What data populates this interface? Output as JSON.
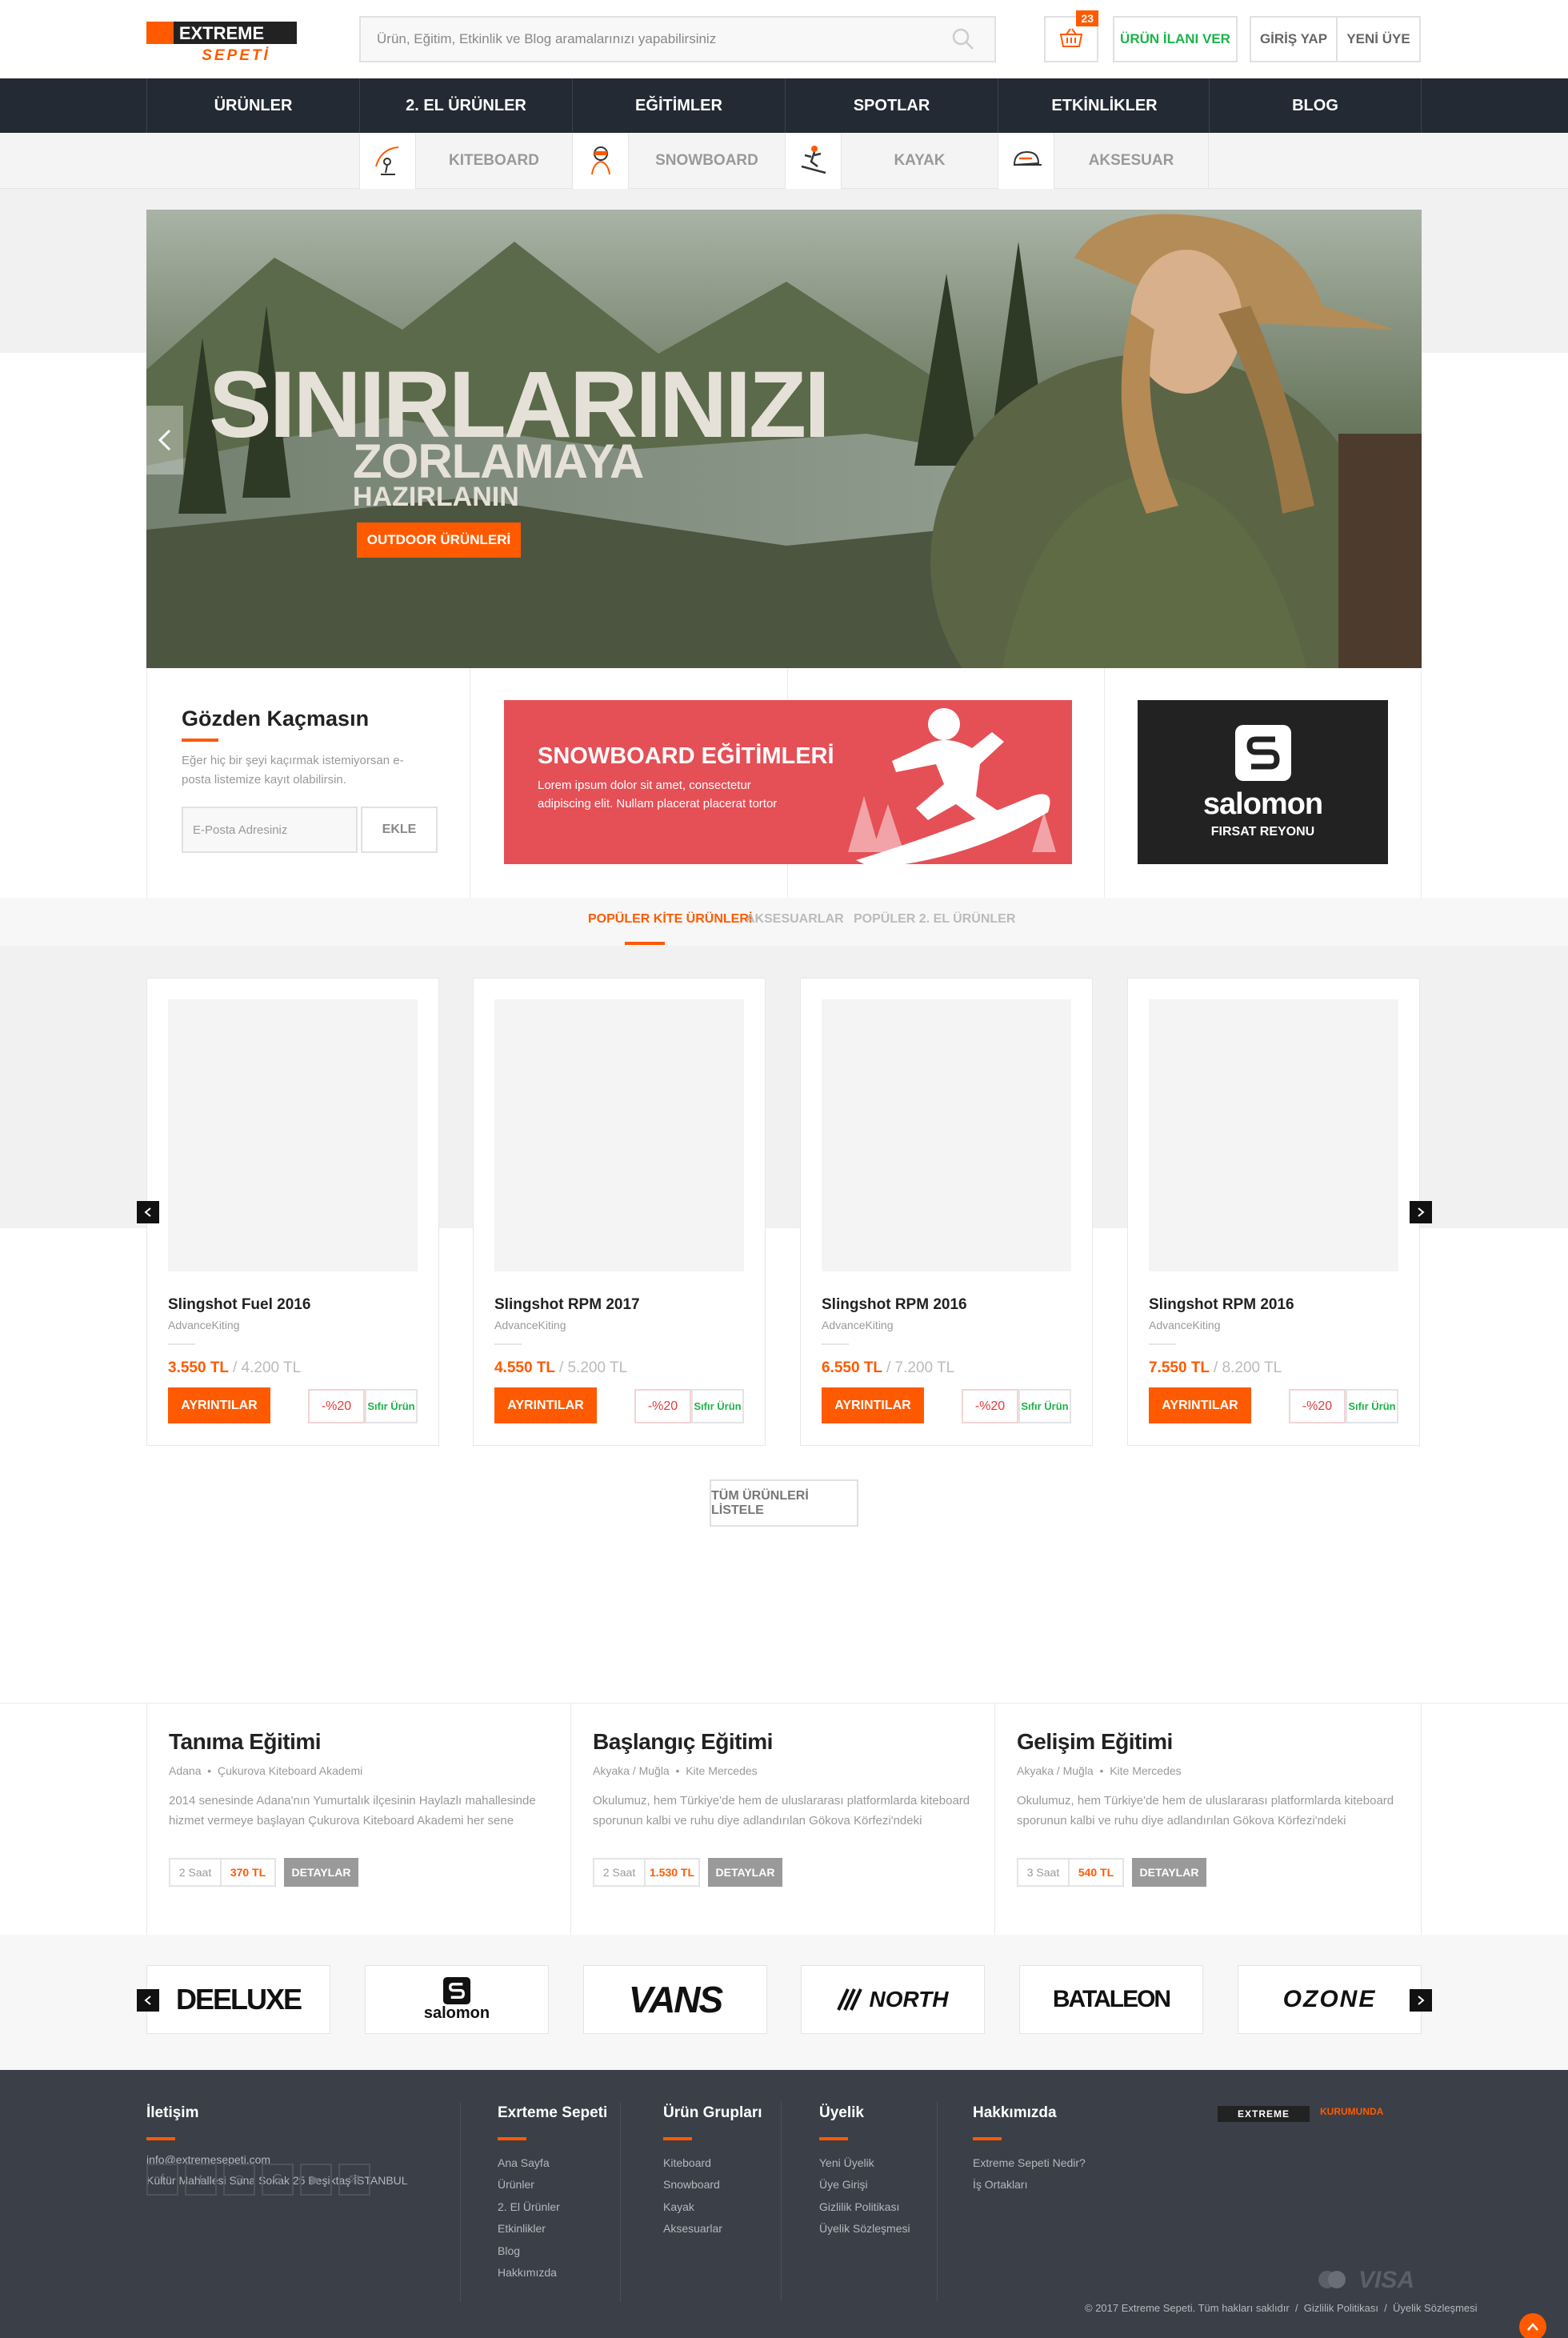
{
  "header": {
    "logo_top": "EXTREME",
    "logo_bottom": "SEPETİ",
    "search_placeholder": "Ürün, Eğitim, Etkinlik ve Blog aramalarınızı yapabilirsiniz",
    "cart_count": "23",
    "post_ad_label": "ÜRÜN İLANI VER",
    "login_label": "GİRİŞ YAP",
    "register_label": "YENİ ÜYE"
  },
  "nav": {
    "items": [
      "ÜRÜNLER",
      "2. EL ÜRÜNLER",
      "EĞİTİMLER",
      "SPOTLAR",
      "ETKİNLİKLER",
      "BLOG"
    ]
  },
  "subnav": {
    "items": [
      {
        "label": "KITEBOARD",
        "icon": "kiteboard-icon"
      },
      {
        "label": "SNOWBOARD",
        "icon": "snowboard-icon"
      },
      {
        "label": "KAYAK",
        "icon": "ski-icon"
      },
      {
        "label": "AKSESUAR",
        "icon": "cap-icon"
      }
    ]
  },
  "hero": {
    "title": "SINIRLARINIZI",
    "subtitle1": "ZORLAMAYA",
    "subtitle2": "HAZIRLANIN",
    "button": "OUTDOOR ÜRÜNLERİ"
  },
  "newsletter": {
    "title": "Gözden Kaçmasın",
    "desc": "Eğer hiç bir şeyi kaçırmak istemiyorsan e-posta listemize kayıt olabilirsin.",
    "placeholder": "E-Posta Adresiniz",
    "button": "EKLE"
  },
  "snowboard_banner": {
    "title": "SNOWBOARD EĞİTİMLERİ",
    "desc": "Lorem ipsum dolor sit amet, consectetur adipiscing elit. Nullam placerat placerat tortor"
  },
  "salomon_banner": {
    "brand": "salomon",
    "subtitle": "FIRSAT REYONU"
  },
  "tabs": [
    "POPÜLER KİTE ÜRÜNLERİ",
    "AKSESUARLAR",
    "POPÜLER 2. EL ÜRÜNLER"
  ],
  "products": [
    {
      "name": "Slingshot Fuel 2016",
      "brand": "AdvanceKiting",
      "price": "3.550 TL",
      "old_price": "/ 4.200 TL",
      "button": "AYRINTILAR",
      "discount": "-%20",
      "badge": "Sıfır Ürün"
    },
    {
      "name": "Slingshot RPM 2017",
      "brand": "AdvanceKiting",
      "price": "4.550 TL",
      "old_price": "/ 5.200 TL",
      "button": "AYRINTILAR",
      "discount": "-%20",
      "badge": "Sıfır Ürün"
    },
    {
      "name": "Slingshot RPM 2016",
      "brand": "AdvanceKiting",
      "price": "6.550 TL",
      "old_price": "/ 7.200 TL",
      "button": "AYRINTILAR",
      "discount": "-%20",
      "badge": "Sıfır Ürün"
    },
    {
      "name": "Slingshot RPM 2016",
      "brand": "AdvanceKiting",
      "price": "7.550 TL",
      "old_price": "/ 8.200 TL",
      "button": "AYRINTILAR",
      "discount": "-%20",
      "badge": "Sıfır Ürün"
    }
  ],
  "all_products_button": "TÜM ÜRÜNLERİ LİSTELE",
  "trainings": [
    {
      "title": "Tanıma Eğitimi",
      "location": "Adana",
      "school": "Çukurova Kiteboard Akademi",
      "desc": "2014 senesinde Adana'nın Yumurtalık ilçesinin Haylazlı mahallesinde hizmet vermeye başlayan Çukurova Kiteboard Akademi her sene genişleyen...",
      "duration": "2 Saat",
      "price": "370 TL",
      "button": "DETAYLAR"
    },
    {
      "title": "Başlangıç Eğitimi",
      "location": "Akyaka / Muğla",
      "school": "Kite Mercedes",
      "desc": "Okulumuz, hem Türkiye'de hem de uluslararası platformlarda kiteboard sporunun kalbi ve ruhu diye adlandırılan Gökova Körfezi'ndeki Akçapınar...",
      "duration": "2 Saat",
      "price": "1.530 TL",
      "button": "DETAYLAR"
    },
    {
      "title": "Gelişim Eğitimi",
      "location": "Akyaka / Muğla",
      "school": "Kite Mercedes",
      "desc": "Okulumuz, hem Türkiye'de hem de uluslararası platformlarda kiteboard sporunun kalbi ve ruhu diye adlandırılan Gökova Körfezi'ndeki Akçapınar...",
      "duration": "3 Saat",
      "price": "540 TL",
      "button": "DETAYLAR"
    }
  ],
  "brands": [
    "DEELUXE",
    "salomon",
    "VANS",
    "NORTH",
    "BATALEON",
    "OZONE"
  ],
  "footer": {
    "contact_title": "İletişim",
    "email": "info@extremesepeti.com",
    "address": "Kültür Mahallesi Suna Sokak 25 Beşiktaş İSTANBUL",
    "social": [
      "facebook-icon",
      "twitter-icon",
      "instagram-icon",
      "google-plus-icon",
      "youtube-icon",
      "mail-icon"
    ],
    "col1_title": "Exrteme Sepeti",
    "col1_links": [
      "Ana Sayfa",
      "Ürünler",
      "2. El Ürünler",
      "Etkinlikler",
      "Blog",
      "Hakkımızda"
    ],
    "col2_title": "Ürün Grupları",
    "col2_links": [
      "Kiteboard",
      "Snowboard",
      "Kayak",
      "Aksesuarlar"
    ],
    "col3_title": "Üyelik",
    "col3_links": [
      "Yeni Üyelik",
      "Üye Girişi",
      "Gizlilik Politikası",
      "Üyelik Sözleşmesi"
    ],
    "col4_title": "Hakkımızda",
    "col4_links": [
      "Extreme Sepeti Nedir?",
      "İş Ortakları"
    ],
    "logo_small": "EXTREME",
    "partner": "KURUMUNDA",
    "copyright": "© 2017 Extreme Sepeti. Tüm hakları saklıdır",
    "privacy": "Gizlilik Politikası",
    "terms": "Üyelik Sözleşmesi",
    "card_brand": "VISA"
  },
  "colors": {
    "accent": "#ff5a00",
    "nav_bg": "#232a33",
    "footer_bg": "#3a3f48",
    "snowboard_red": "#e54f56",
    "green": "#1db34a"
  }
}
